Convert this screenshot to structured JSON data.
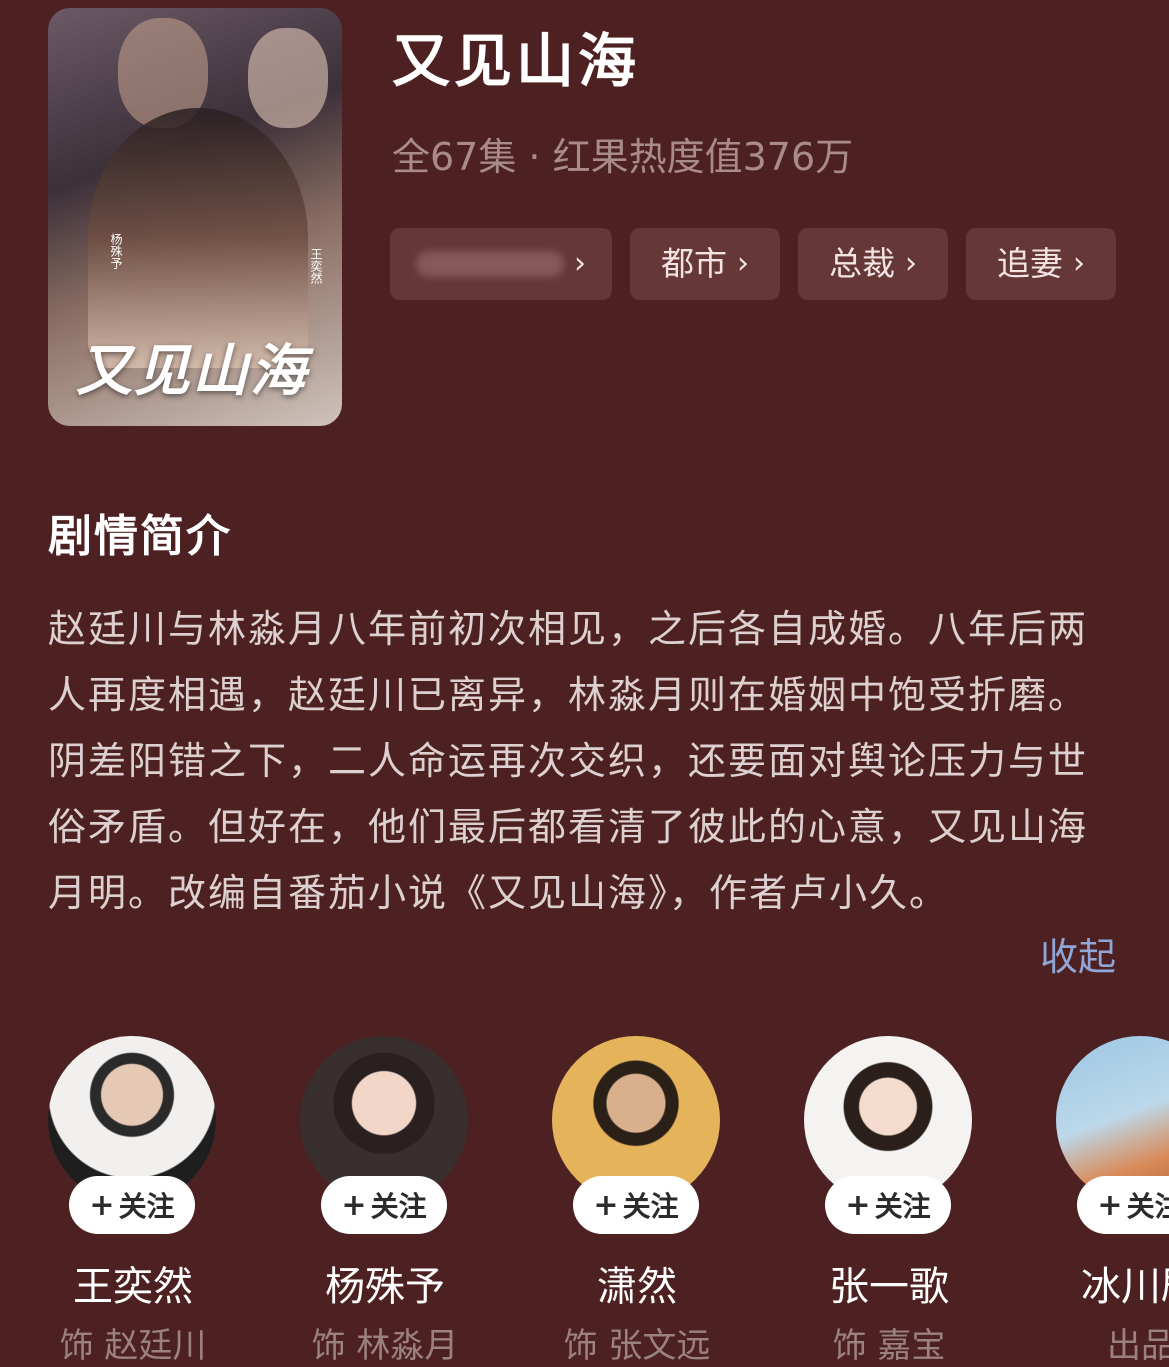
{
  "show": {
    "title": "又见山海",
    "meta": "全67集 · 红果热度值376万",
    "poster_title": "又见山海",
    "poster_actor_left": "杨殊予",
    "poster_actor_right": "王奕然"
  },
  "tags": [
    {
      "label": ""
    },
    {
      "label": "都市"
    },
    {
      "label": "总裁"
    },
    {
      "label": "追妻"
    }
  ],
  "synopsis": {
    "heading": "剧情简介",
    "text": "赵廷川与林淼月八年前初次相见，之后各自成婚。八年后两人再度相遇，赵廷川已离异，林淼月则在婚姻中饱受折磨。阴差阳错之下，二人命运再次交织，还要面对舆论压力与世俗矛盾。但好在，他们最后都看清了彼此的心意，又见山海月明。改编自番茄小说《又见山海》，作者卢小久。",
    "collapse_label": "收起"
  },
  "cast": [
    {
      "name": "王奕然",
      "role": "饰 赵廷川",
      "follow": "关注"
    },
    {
      "name": "杨殊予",
      "role": "饰 林淼月",
      "follow": "关注"
    },
    {
      "name": "潇然",
      "role": "饰 张文远",
      "follow": "关注"
    },
    {
      "name": "张一歌",
      "role": "饰 嘉宝",
      "follow": "关注"
    },
    {
      "name": "冰川剧",
      "role": "出品",
      "follow": "关注"
    }
  ],
  "icons": {
    "chevron": "chevron-right-icon",
    "plus": "plus-icon"
  },
  "colors": {
    "background": "#4d2121",
    "tag_bg": "#653737",
    "link": "#8fa6d6"
  }
}
